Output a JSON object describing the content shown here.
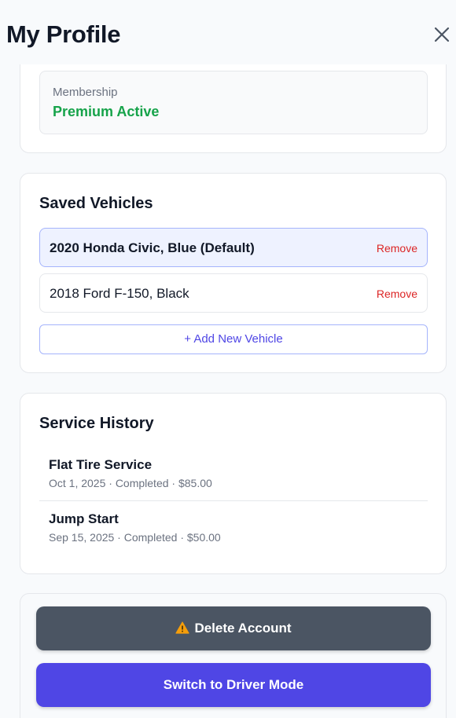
{
  "header": {
    "title": "My Profile",
    "close_icon": "close-icon"
  },
  "membership": {
    "label": "Membership",
    "value": "Premium Active",
    "value_color": "#16a34a"
  },
  "vehicles": {
    "title": "Saved Vehicles",
    "items": [
      {
        "name": "2020 Honda Civic, Blue (Default)",
        "default": true,
        "remove_label": "Remove"
      },
      {
        "name": "2018 Ford F-150, Black",
        "default": false,
        "remove_label": "Remove"
      }
    ],
    "add_label": "+ Add New Vehicle"
  },
  "history": {
    "title": "Service History",
    "items": [
      {
        "name": "Flat Tire Service",
        "meta": "Oct 1, 2025 · Completed · $85.00"
      },
      {
        "name": "Jump Start",
        "meta": "Sep 15, 2025 · Completed · $50.00"
      }
    ]
  },
  "actions": {
    "delete_label": "Delete Account",
    "delete_icon": "warning-icon",
    "driver_label": "Switch to Driver Mode"
  },
  "colors": {
    "accent": "#4f46e5",
    "danger": "#dc2626",
    "delete_button": "#4b5563"
  }
}
